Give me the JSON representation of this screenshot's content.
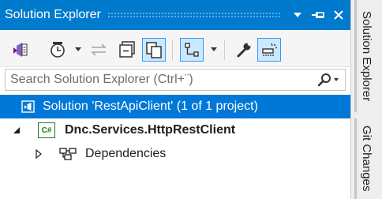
{
  "window": {
    "title": "Solution Explorer"
  },
  "search": {
    "placeholder": "Search Solution Explorer (Ctrl+¨)"
  },
  "tree": {
    "solution_label": "Solution 'RestApiClient' (1 of 1 project)",
    "project_label": "Dnc.Services.HttpRestClient",
    "project_badge": "C#",
    "dependencies_label": "Dependencies"
  },
  "side_tabs": {
    "solution_explorer": "Solution Explorer",
    "git_changes": "Git Changes"
  },
  "colors": {
    "accent": "#007acc",
    "selection": "#0078d7",
    "active_tool_border": "#3399ff",
    "active_tool_bg": "#cce8ff"
  },
  "icons": {
    "vs_icon": "visual-studio-icon",
    "history": "pending-changes-clock-icon",
    "sync": "sync-with-active-document-icon",
    "collapse": "collapse-all-icon",
    "show_all": "show-all-files-icon",
    "view_switch": "switch-views-icon",
    "properties": "properties-wrench-icon",
    "preview": "preview-selected-items-icon"
  }
}
